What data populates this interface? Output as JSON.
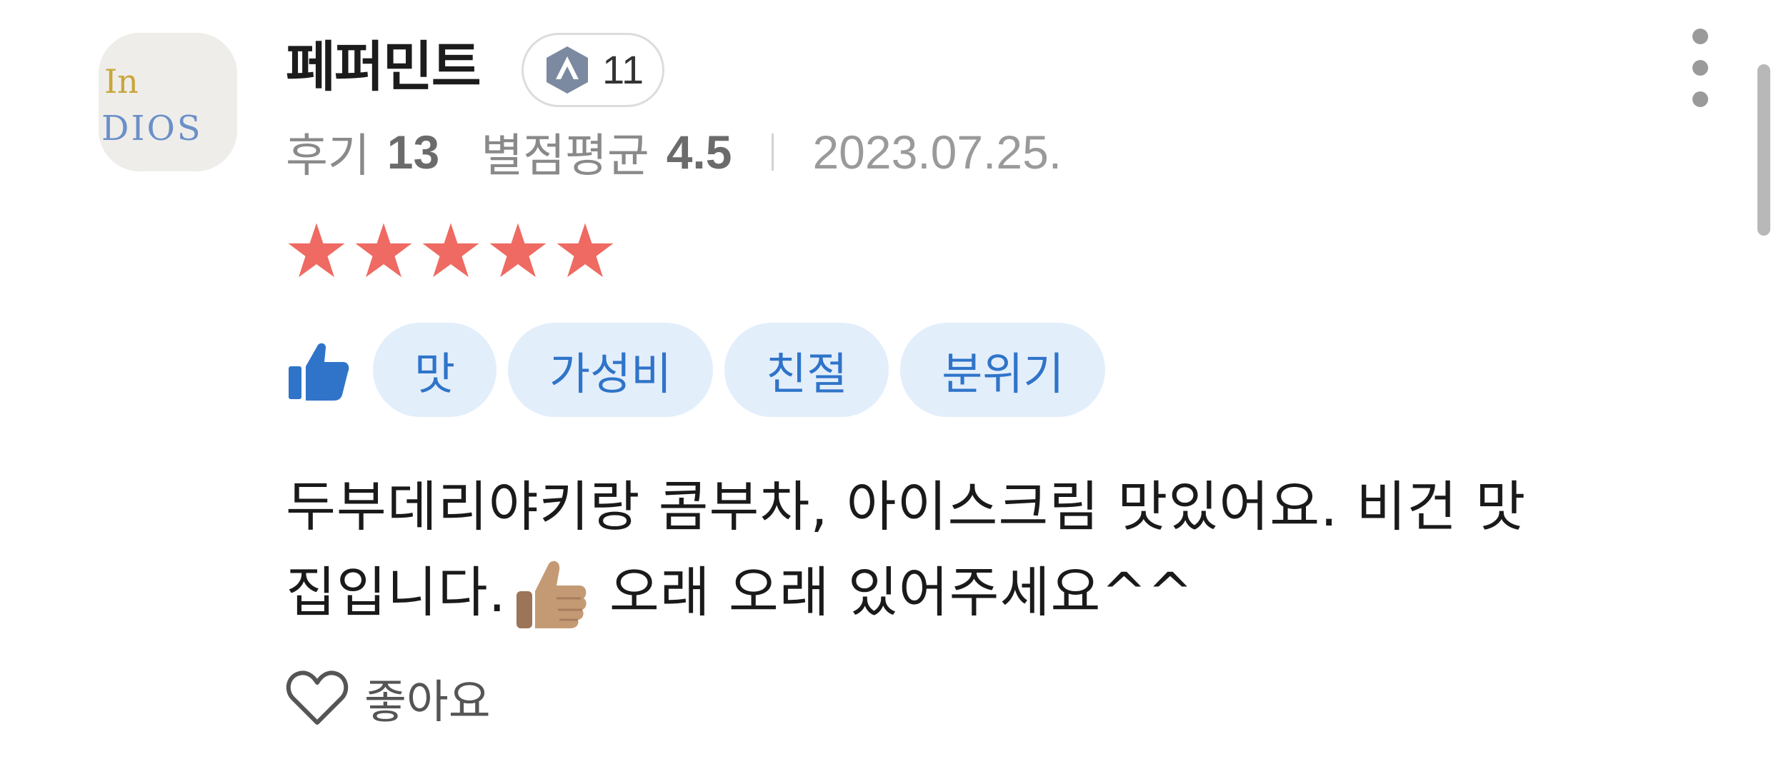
{
  "review": {
    "author": {
      "name": "페퍼민트",
      "level": "11",
      "avatar_text_line1": "In",
      "avatar_text_line2": "DIOS"
    },
    "stats": {
      "review_count_label": "후기",
      "review_count": "13",
      "rating_avg_label": "별점평균",
      "rating_avg": "4.5",
      "date": "2023.07.25."
    },
    "rating": {
      "stars": 5,
      "max": 5,
      "color": "#ee6a62"
    },
    "tags": {
      "icon": "thumbs-up-icon",
      "items": [
        {
          "label": "맛"
        },
        {
          "label": "가성비"
        },
        {
          "label": "친절"
        },
        {
          "label": "분위기"
        }
      ]
    },
    "body": {
      "line1": "두부데리야키랑 콤부차, 아이스크림 맛있어요. 비건 맛",
      "line2_before": "집입니다.",
      "emoji": "thumbs-up-emoji",
      "line2_after": "오래 오래 있어주세요^^"
    },
    "like": {
      "label": "좋아요",
      "icon": "heart-outline-icon"
    },
    "menu_icon": "more-vertical-icon"
  },
  "colors": {
    "accent_blue": "#2f74c9",
    "tag_bg": "#e3eefb",
    "star": "#ee6a62",
    "level_badge": "#7b8aa0"
  }
}
